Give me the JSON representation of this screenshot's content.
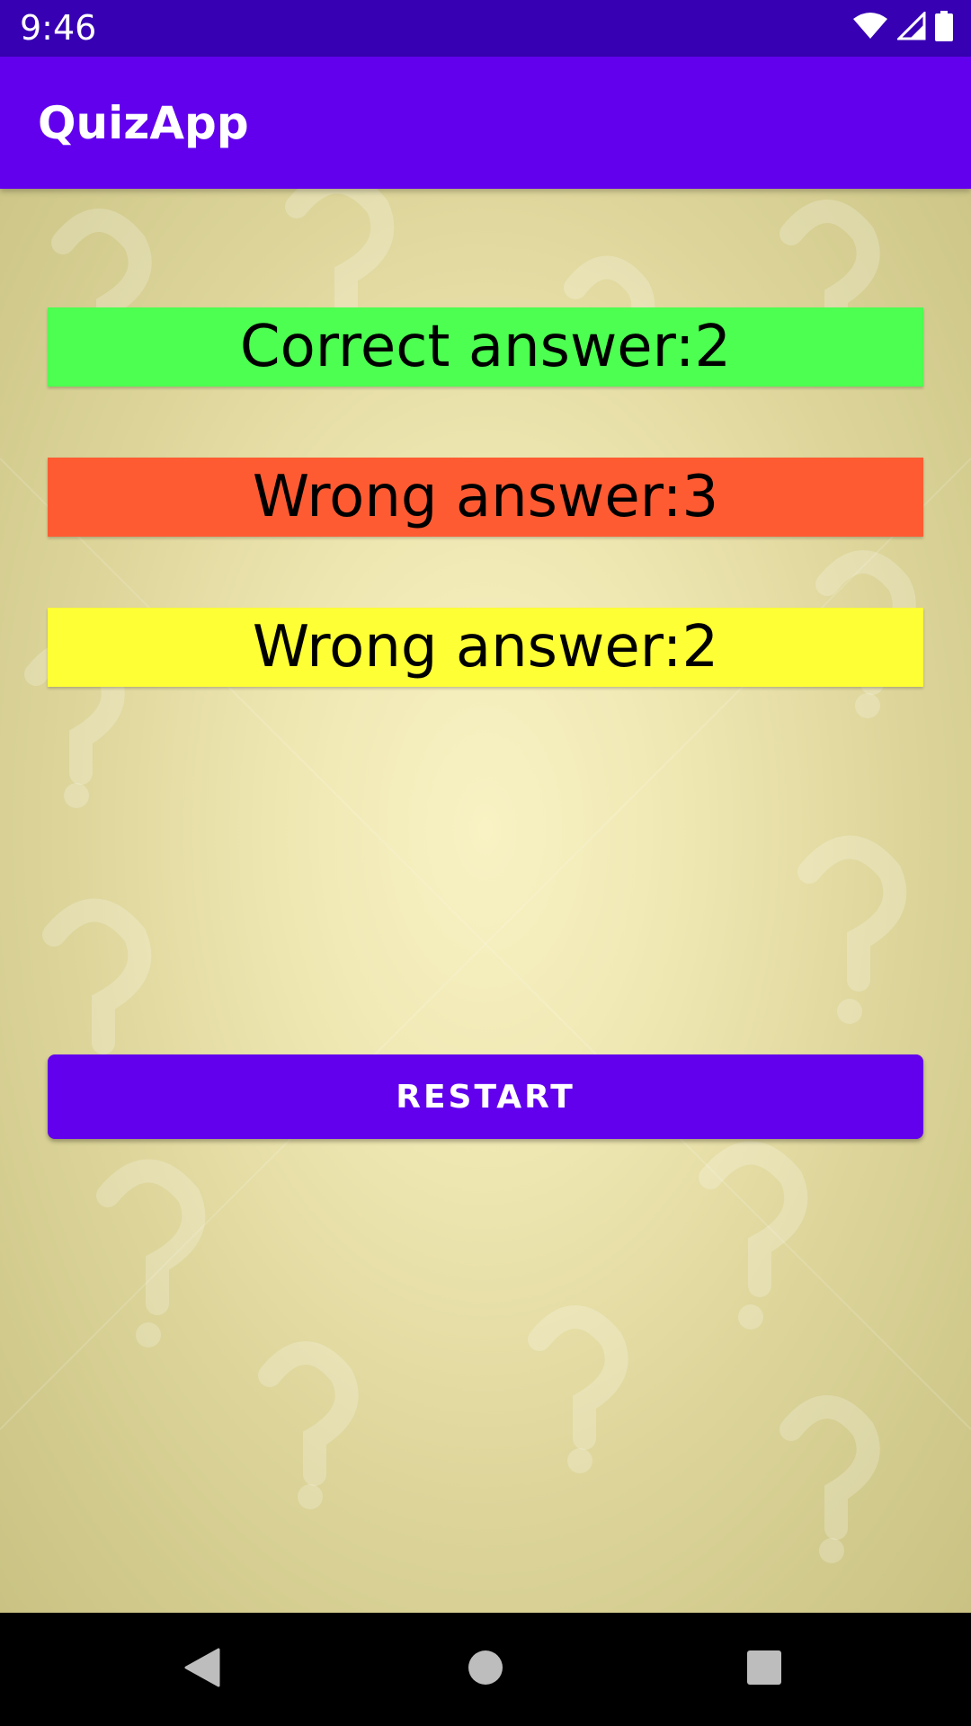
{
  "status_bar": {
    "time": "9:46",
    "icons": [
      "wifi-icon",
      "signal-icon",
      "battery-icon"
    ]
  },
  "app_bar": {
    "title": "QuizApp"
  },
  "results": {
    "correct_label": "Correct answer:2",
    "wrong_label": "Wrong answer:3",
    "second_wrong_label": "Wrong answer:2"
  },
  "restart_label": "RESTART",
  "nav_bar": {
    "icons": [
      "back-icon",
      "home-icon",
      "recents-icon"
    ]
  },
  "colors": {
    "status_bar": "#3700B3",
    "app_bar": "#6200EE",
    "correct": "#4CFF50",
    "wrong": "#FF5B32",
    "skipped": "#FFFF35",
    "button": "#6200EE"
  }
}
